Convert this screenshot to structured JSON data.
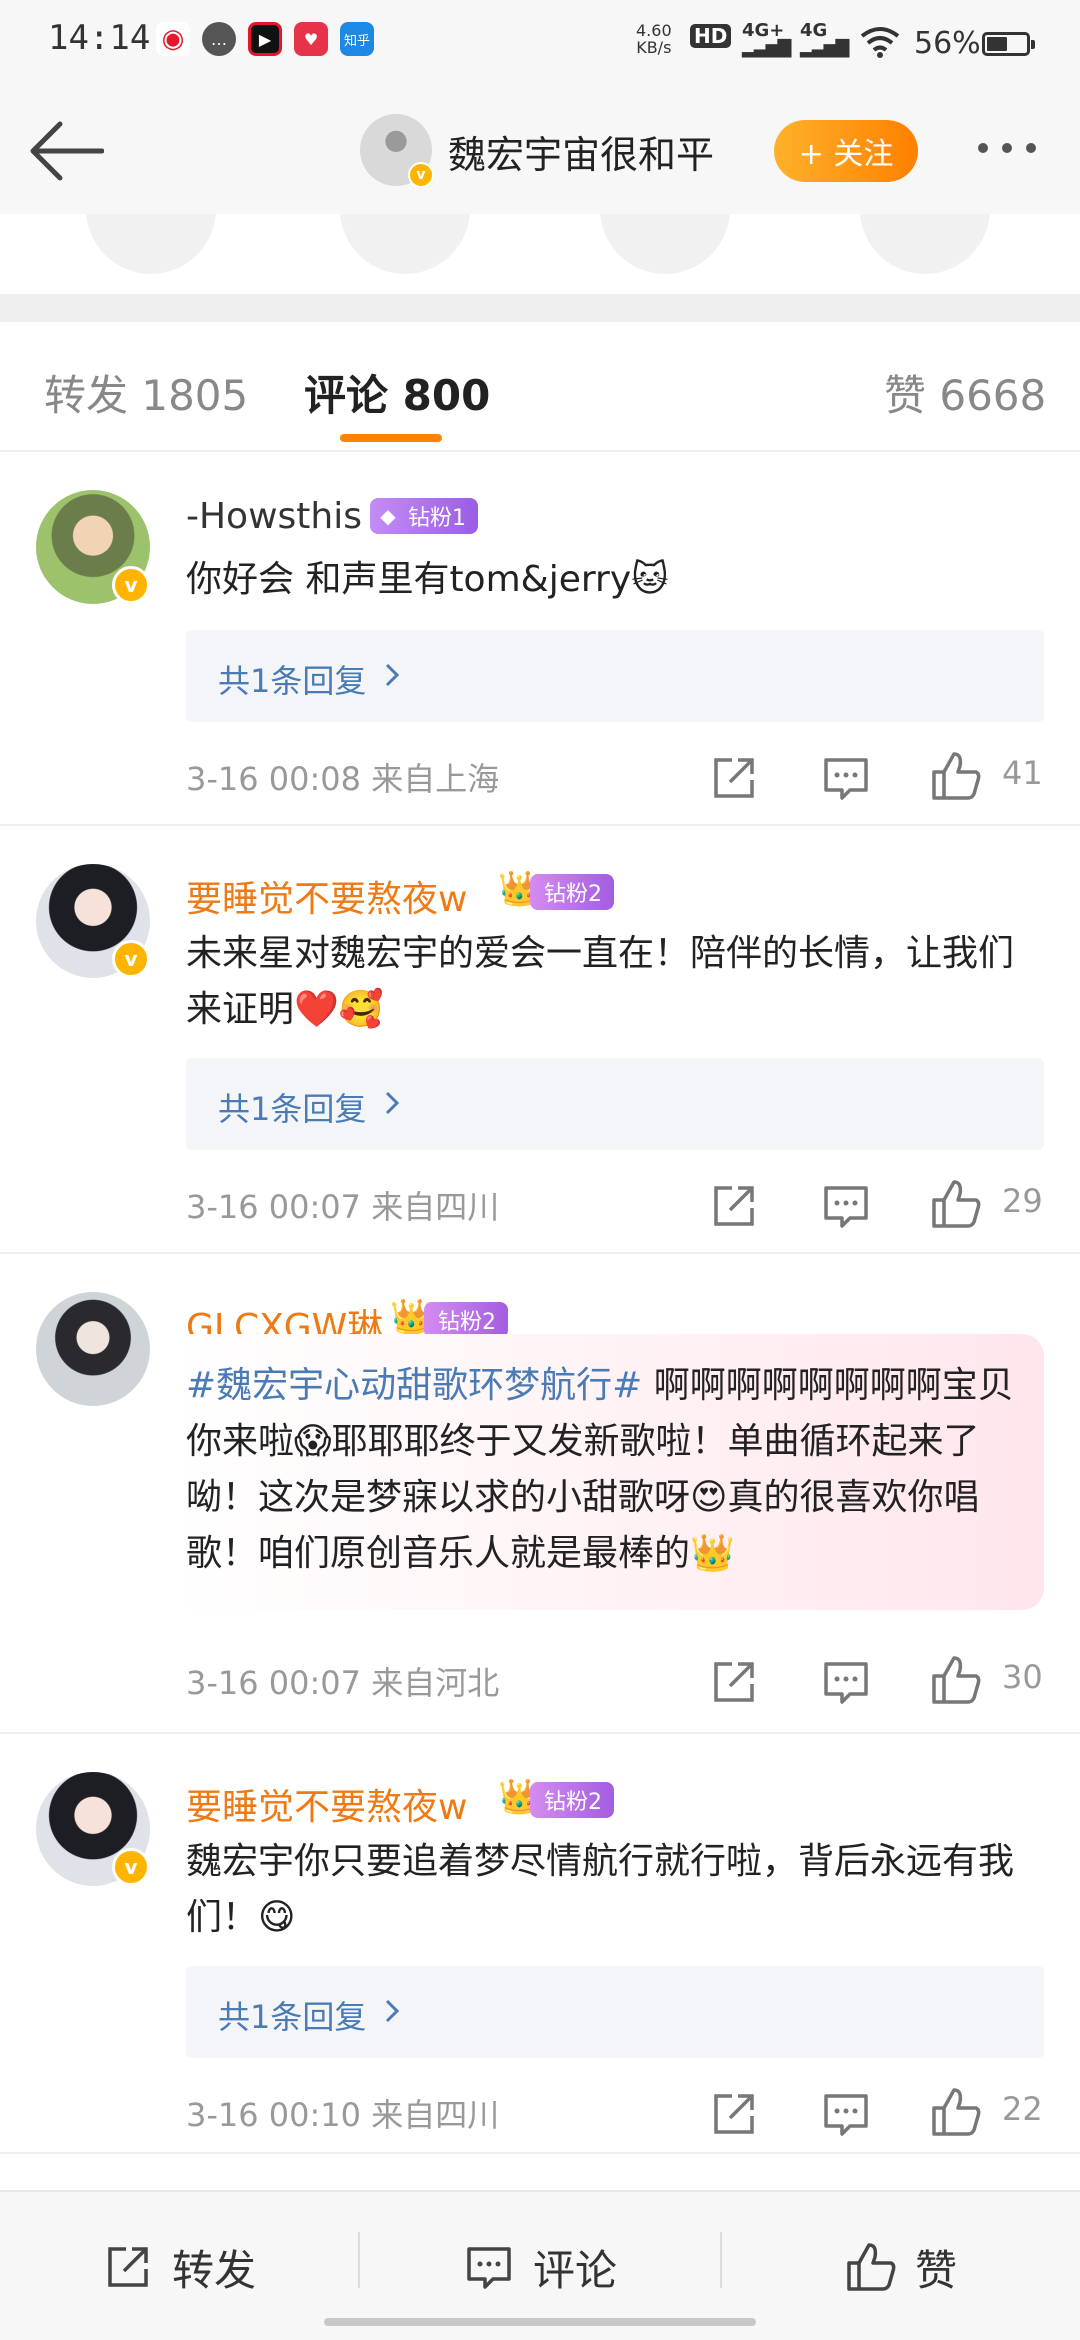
{
  "status_bar": {
    "time": "14:14",
    "app_icons": [
      "weibo-icon",
      "message-icon",
      "video-app-icon",
      "shop-app-icon",
      "zhihu-icon"
    ],
    "zhihu_label": "知乎",
    "speed_top": "4.60",
    "speed_bottom": "KB/s",
    "hd_label": "HD",
    "net1": "4G+",
    "net2": "4G",
    "battery": "56%"
  },
  "header": {
    "name": "魏宏宇宙很和平",
    "follow_label": "+ 关注"
  },
  "tabs": {
    "repost": "转发 1805",
    "comments": "评论 800",
    "likes": "赞 6668"
  },
  "comments": [
    {
      "username": "-Howsthis",
      "badge": "钻粉1",
      "text": "你好会 和声里有tom&jerry🐱",
      "replies": "共1条回复",
      "meta": "3-16 00:08  来自上海",
      "likes": "41",
      "verified": true
    },
    {
      "username": "要睡觉不要熬夜w",
      "badge": "钻粉2",
      "text": "未来星对魏宏宇的爱会一直在！陪伴的长情，让我们来证明❤️🥰",
      "replies": "共1条回复",
      "meta": "3-16 00:07  来自四川",
      "likes": "29",
      "verified": true
    },
    {
      "username": "GLCXGW琳",
      "badge": "钻粉2",
      "hashtag": "#魏宏宇心动甜歌环梦航行#",
      "text": " 啊啊啊啊啊啊啊啊宝贝你来啦😱耶耶耶终于又发新歌啦！单曲循环起来了呦！这次是梦寐以求的小甜歌呀😍真的很喜欢你唱歌！咱们原创音乐人就是最棒的👑",
      "meta": "3-16 00:07  来自河北",
      "likes": "30",
      "verified": false
    },
    {
      "username": "要睡觉不要熬夜w",
      "badge": "钻粉2",
      "text": "魏宏宇你只要追着梦尽情航行就行啦，背后永远有我们！😋",
      "replies": "共1条回复",
      "meta": "3-16 00:10  来自四川",
      "likes": "22",
      "verified": true
    }
  ],
  "bottom_bar": {
    "repost": "转发",
    "comment": "评论",
    "like": "赞"
  },
  "colors": {
    "accent": "#ff8200",
    "vip_name": "#ef7a14",
    "link": "#4a7bb5",
    "verified": "#ffb400"
  }
}
